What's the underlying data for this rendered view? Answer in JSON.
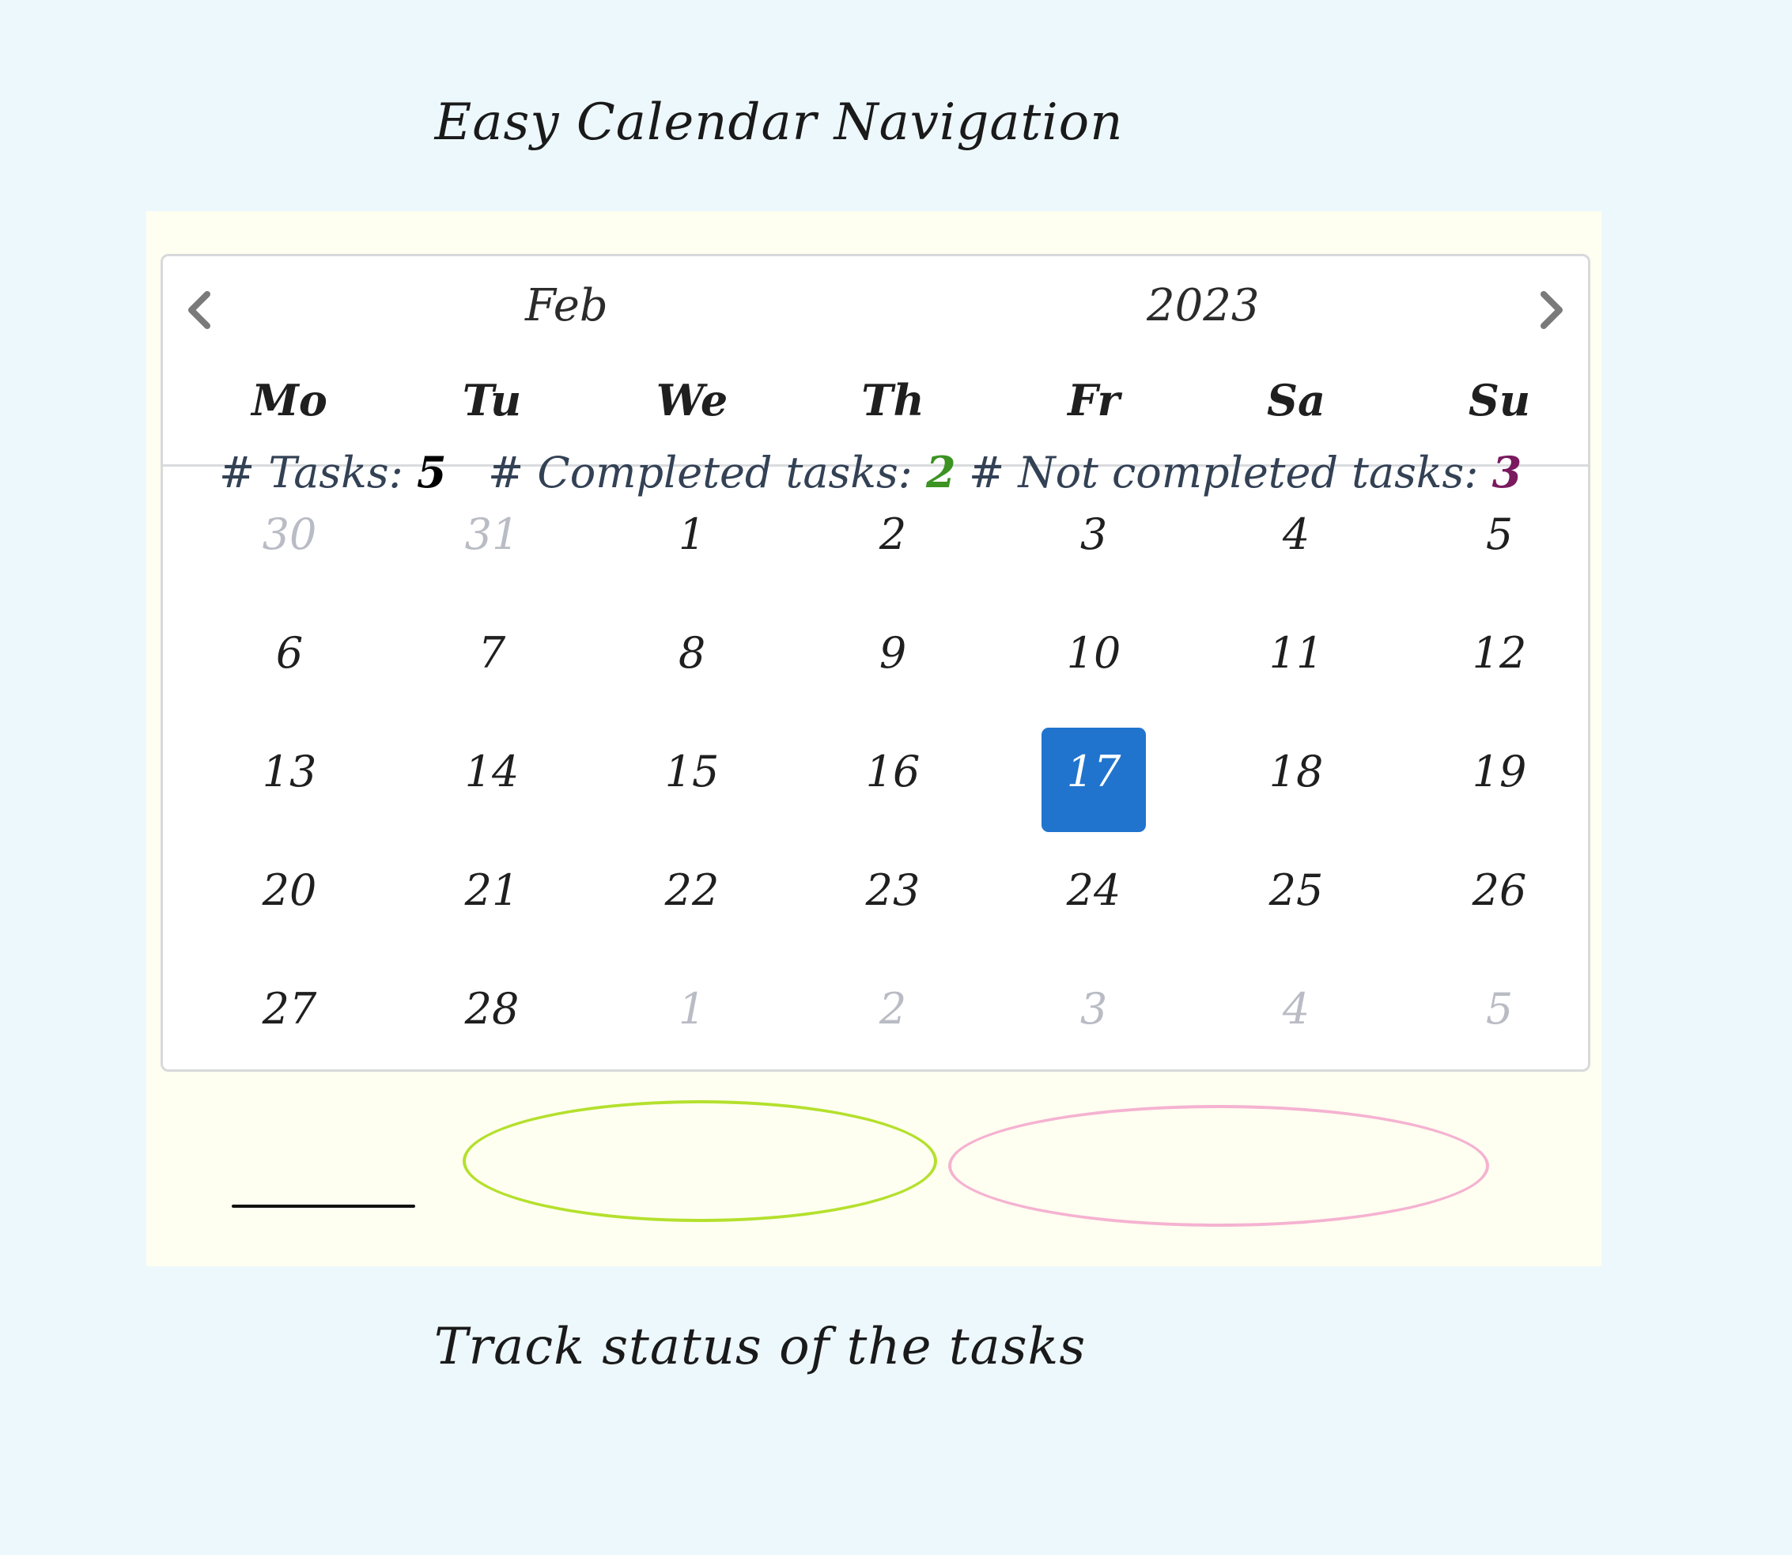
{
  "captions": {
    "top": "Easy Calendar Navigation",
    "bottom": "Track status of the tasks"
  },
  "calendar": {
    "month": "Feb",
    "year": "2023",
    "prev_icon": "chevron-left-icon",
    "next_icon": "chevron-right-icon",
    "weekdays": [
      "Mo",
      "Tu",
      "We",
      "Th",
      "Fr",
      "Sa",
      "Su"
    ],
    "days": [
      {
        "label": "30",
        "muted": true
      },
      {
        "label": "31",
        "muted": true
      },
      {
        "label": "1",
        "muted": false
      },
      {
        "label": "2",
        "muted": false
      },
      {
        "label": "3",
        "muted": false
      },
      {
        "label": "4",
        "muted": false
      },
      {
        "label": "5",
        "muted": false
      },
      {
        "label": "6",
        "muted": false
      },
      {
        "label": "7",
        "muted": false
      },
      {
        "label": "8",
        "muted": false
      },
      {
        "label": "9",
        "muted": false
      },
      {
        "label": "10",
        "muted": false
      },
      {
        "label": "11",
        "muted": false
      },
      {
        "label": "12",
        "muted": false
      },
      {
        "label": "13",
        "muted": false
      },
      {
        "label": "14",
        "muted": false
      },
      {
        "label": "15",
        "muted": false
      },
      {
        "label": "16",
        "muted": false
      },
      {
        "label": "17",
        "muted": false,
        "selected": true
      },
      {
        "label": "18",
        "muted": false
      },
      {
        "label": "19",
        "muted": false
      },
      {
        "label": "20",
        "muted": false
      },
      {
        "label": "21",
        "muted": false
      },
      {
        "label": "22",
        "muted": false
      },
      {
        "label": "23",
        "muted": false
      },
      {
        "label": "24",
        "muted": false
      },
      {
        "label": "25",
        "muted": false
      },
      {
        "label": "26",
        "muted": false
      },
      {
        "label": "27",
        "muted": false
      },
      {
        "label": "28",
        "muted": false
      },
      {
        "label": "1",
        "muted": true
      },
      {
        "label": "2",
        "muted": true
      },
      {
        "label": "3",
        "muted": true
      },
      {
        "label": "4",
        "muted": true
      },
      {
        "label": "5",
        "muted": true
      }
    ],
    "selected_color": "#2074ce"
  },
  "stats": {
    "total_label": "# Tasks: ",
    "total_value": "5",
    "completed_label": "# Completed tasks: ",
    "completed_value": "2",
    "not_completed_label": "# Not completed tasks: ",
    "not_completed_value": "3",
    "colors": {
      "completed": "#3c9322",
      "not_completed": "#7a1a5e",
      "highlight_green": "#b4e02d",
      "highlight_pink": "#f5b2d1"
    }
  }
}
